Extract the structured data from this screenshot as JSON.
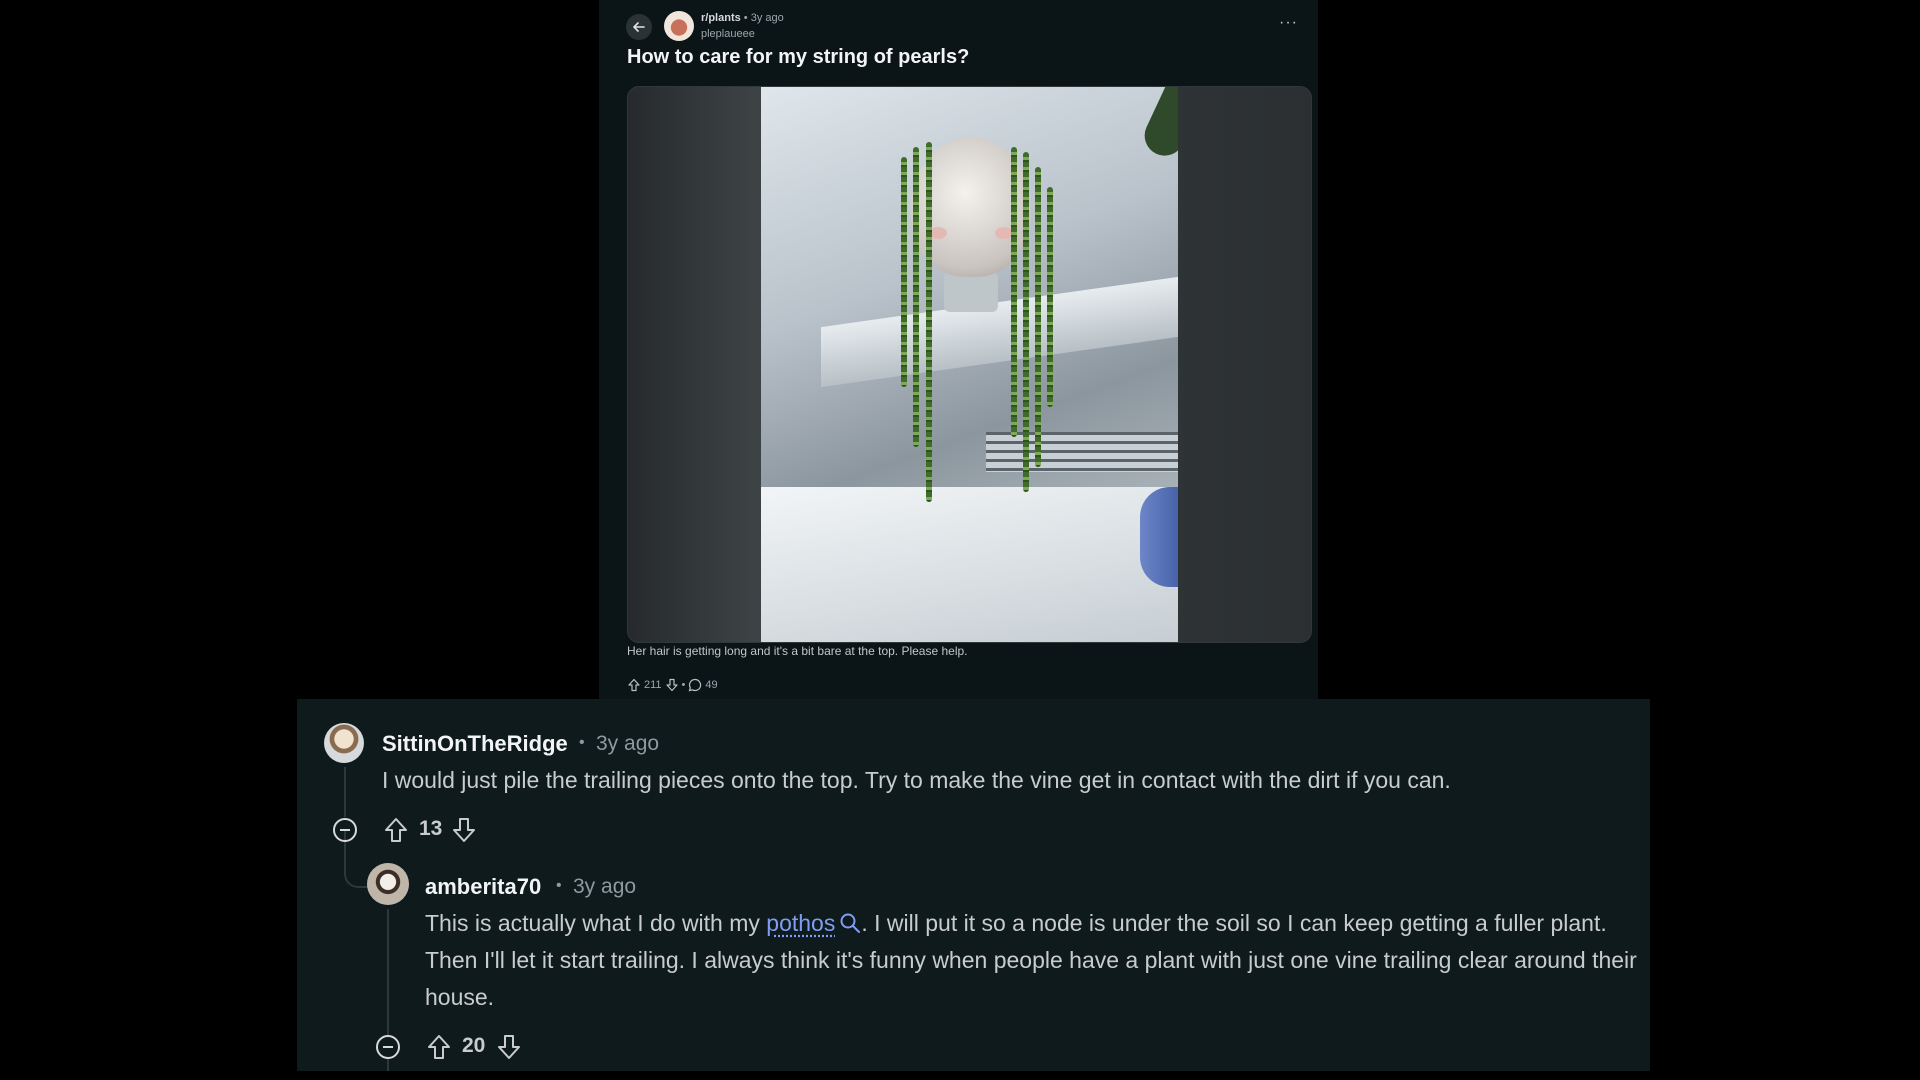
{
  "post": {
    "subreddit": "r/plants",
    "separator": "•",
    "age": "3y ago",
    "author": "pleplaueee",
    "title": "How to care for my string of pearls?",
    "caption": "Her hair is getting long and it's a bit bare at the top. Please help.",
    "upvotes": "211",
    "comments": "49",
    "more_label": "···"
  },
  "comments": [
    {
      "author": "SittinOnTheRidge",
      "separator": "•",
      "age": "3y ago",
      "text": "I would just pile the trailing pieces onto the top. Try to make the vine get in contact with the dirt if you can.",
      "votes": "13"
    },
    {
      "author": "amberita70",
      "separator": "•",
      "age": "3y ago",
      "text_before": "This is actually what I do with my ",
      "link": "pothos",
      "text_after": ". I will put it so a node is under the soil so I can keep getting a fuller plant. Then I'll let it start trailing. I always think it's funny when people have a plant with just one vine trailing clear around their house.",
      "votes": "20"
    }
  ],
  "icons": {
    "back": "arrow-left-icon",
    "more": "more-horizontal-icon",
    "upvote": "arrow-up-icon",
    "downvote": "arrow-down-icon",
    "comment": "comment-bubble-icon",
    "collapse": "minus-circle-icon",
    "search": "search-icon"
  },
  "colors": {
    "page_bg": "#000000",
    "post_bg": "#0b1416",
    "comments_bg": "#0f1a1c",
    "link": "#7f9df2",
    "text": "#c8ccce"
  }
}
